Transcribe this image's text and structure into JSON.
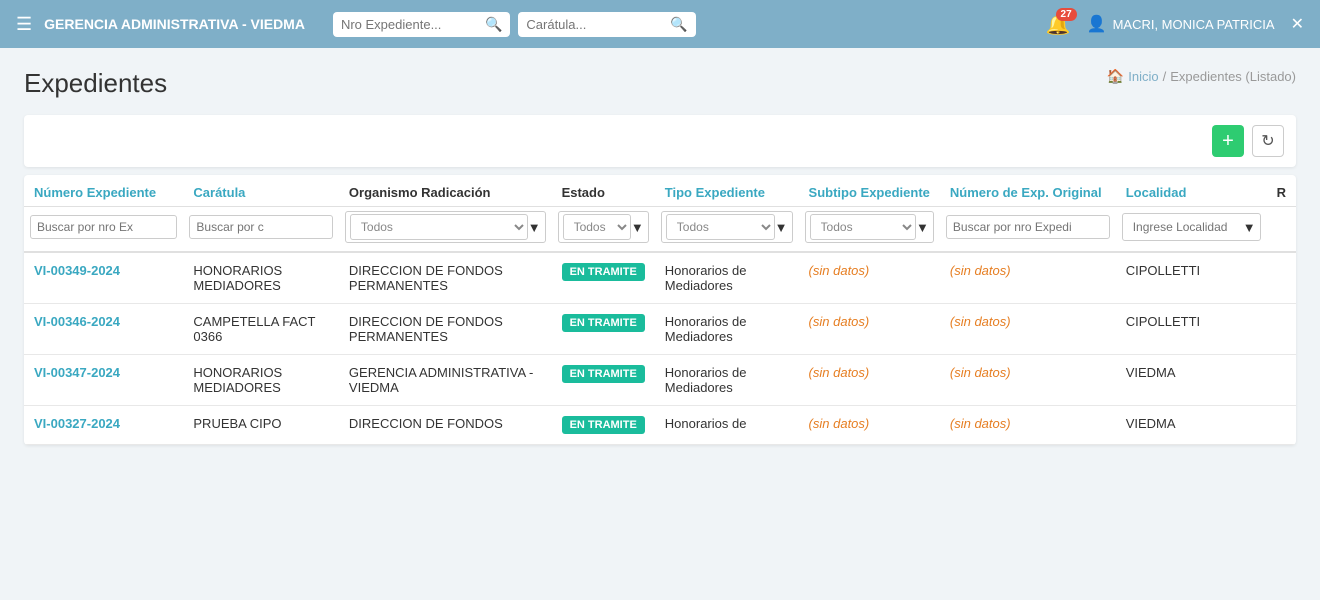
{
  "header": {
    "title": "GERENCIA ADMINISTRATIVA - VIEDMA",
    "search1_placeholder": "Nro Expediente...",
    "search2_placeholder": "Carátula...",
    "notification_count": "27",
    "user_name": "MACRI, MONICA PATRICIA"
  },
  "page": {
    "title": "Expedientes",
    "breadcrumb_home": "Inicio",
    "breadcrumb_separator": "/",
    "breadcrumb_current": "Expedientes (Listado)"
  },
  "toolbar": {
    "add_label": "+",
    "refresh_label": "↻"
  },
  "table": {
    "columns": [
      {
        "key": "num_expediente",
        "label": "Número Expediente",
        "dark": false
      },
      {
        "key": "caratula",
        "label": "Carátula",
        "dark": false
      },
      {
        "key": "organismo",
        "label": "Organismo Radicación",
        "dark": true
      },
      {
        "key": "estado",
        "label": "Estado",
        "dark": true
      },
      {
        "key": "tipo",
        "label": "Tipo Expediente",
        "dark": false
      },
      {
        "key": "subtipo",
        "label": "Subtipo Expediente",
        "dark": false
      },
      {
        "key": "num_exp_original",
        "label": "Número de Exp. Original",
        "dark": false
      },
      {
        "key": "localidad",
        "label": "Localidad",
        "dark": false
      },
      {
        "key": "r",
        "label": "R",
        "dark": true
      }
    ],
    "filters": {
      "num_expediente": "Buscar por nro Ex",
      "caratula": "Buscar por c",
      "organismo": "Todos",
      "estado": "Todos",
      "tipo": "Todos",
      "subtipo": "Todos",
      "num_exp_original": "Buscar por nro Expedi",
      "localidad": "Ingrese Localidad"
    },
    "rows": [
      {
        "num_expediente": "VI-00349-2024",
        "caratula": "HONORARIOS MEDIADORES",
        "organismo": "DIRECCION DE FONDOS PERMANENTES",
        "estado": "EN TRAMITE",
        "tipo": "Honorarios de Mediadores",
        "subtipo": "(sin datos)",
        "num_exp_original": "(sin datos)",
        "localidad": "CIPOLLETTI"
      },
      {
        "num_expediente": "VI-00346-2024",
        "caratula": "CAMPETELLA FACT 0366",
        "organismo": "DIRECCION DE FONDOS PERMANENTES",
        "estado": "EN TRAMITE",
        "tipo": "Honorarios de Mediadores",
        "subtipo": "(sin datos)",
        "num_exp_original": "(sin datos)",
        "localidad": "CIPOLLETTI"
      },
      {
        "num_expediente": "VI-00347-2024",
        "caratula": "HONORARIOS MEDIADORES",
        "organismo": "GERENCIA ADMINISTRATIVA - VIEDMA",
        "estado": "EN TRAMITE",
        "tipo": "Honorarios de Mediadores",
        "subtipo": "(sin datos)",
        "num_exp_original": "(sin datos)",
        "localidad": "VIEDMA"
      },
      {
        "num_expediente": "VI-00327-2024",
        "caratula": "PRUEBA CIPO",
        "organismo": "DIRECCION DE FONDOS",
        "estado": "EN TRAMITE",
        "tipo": "Honorarios de",
        "subtipo": "(sin datos)",
        "num_exp_original": "(sin datos)",
        "localidad": "VIEDMA"
      }
    ]
  }
}
